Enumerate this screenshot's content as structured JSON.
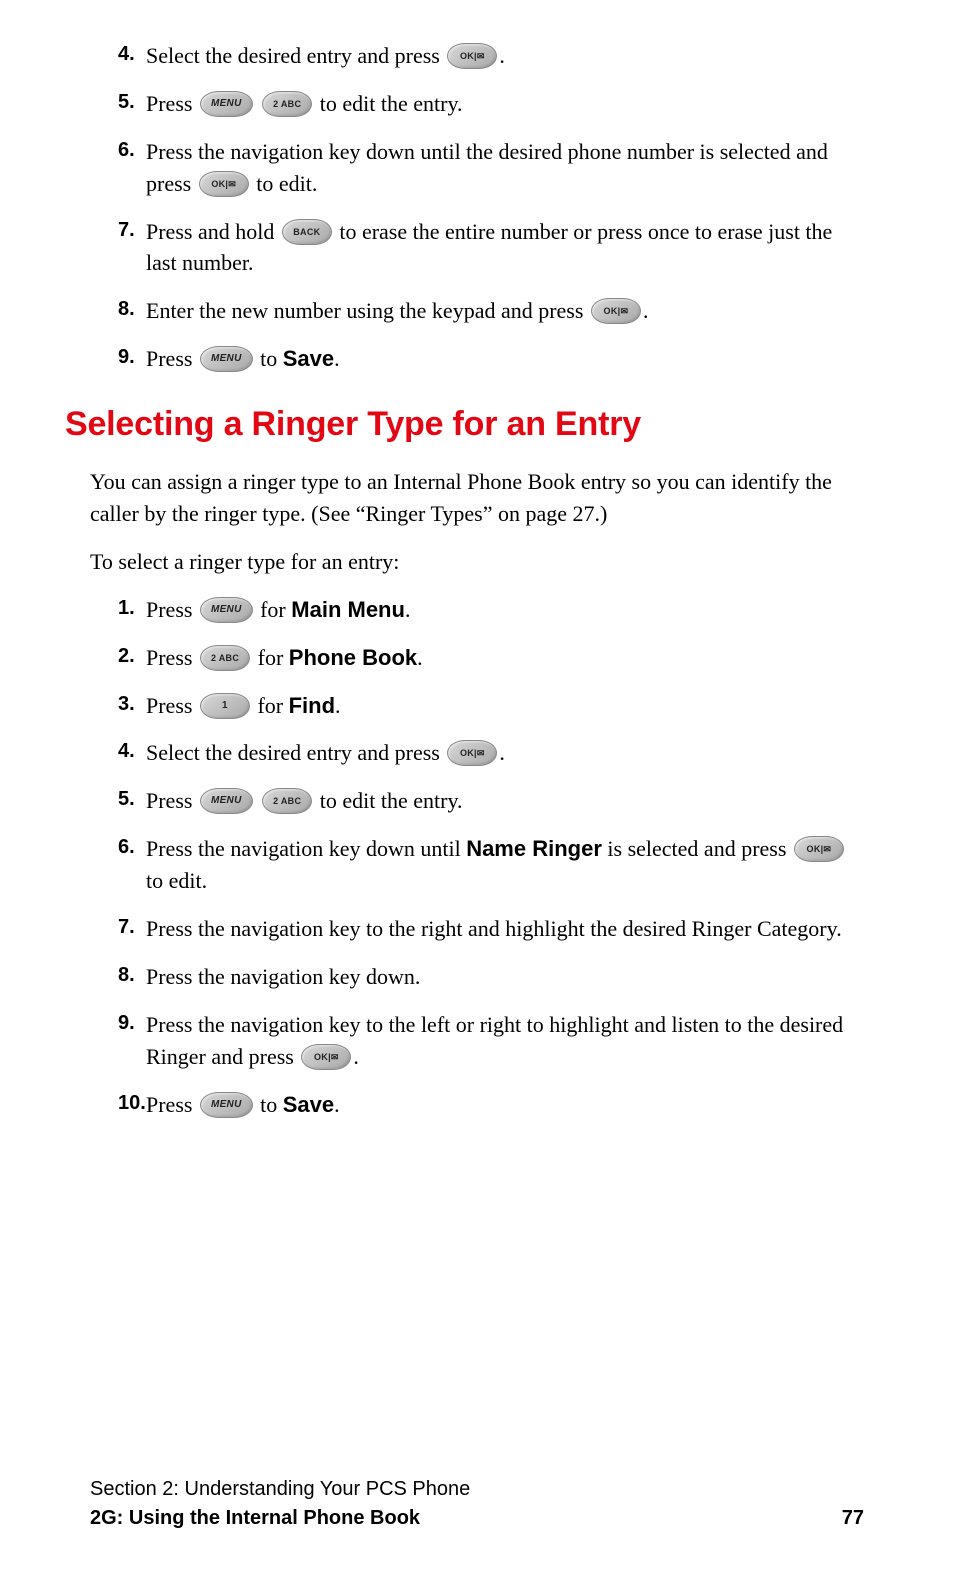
{
  "keys": {
    "ok": "OK|✉",
    "menu": "MENU",
    "two": "2 ABC",
    "one": "1",
    "back": "BACK"
  },
  "list1": {
    "s4": {
      "num": "4.",
      "t1": "Select the desired entry and press ",
      "t2": "."
    },
    "s5": {
      "num": "5.",
      "t1": "Press ",
      "t2": " to edit the entry."
    },
    "s6": {
      "num": "6.",
      "t1": "Press the navigation key down until the desired phone number is selected and press ",
      "t2": " to edit."
    },
    "s7": {
      "num": "7.",
      "t1": "Press and hold ",
      "t2": " to erase the entire number or press once to erase just the last number."
    },
    "s8": {
      "num": "8.",
      "t1": "Enter the new number using the keypad and press ",
      "t2": "."
    },
    "s9": {
      "num": "9.",
      "t1": "Press ",
      "t2": " to ",
      "bold": "Save",
      "t3": "."
    }
  },
  "heading": "Selecting a Ringer Type for an Entry",
  "para1": "You can assign a ringer type to an Internal Phone Book entry so you can identify the caller by the ringer type. (See “Ringer Types” on page 27.)",
  "para2": "To select a ringer type for an entry:",
  "list2": {
    "s1": {
      "num": "1.",
      "t1": "Press ",
      "t2": " for ",
      "bold": "Main Menu",
      "t3": "."
    },
    "s2": {
      "num": "2.",
      "t1": "Press ",
      "t2": " for ",
      "bold": "Phone Book",
      "t3": "."
    },
    "s3": {
      "num": "3.",
      "t1": "Press ",
      "t2": " for ",
      "bold": "Find",
      "t3": "."
    },
    "s4": {
      "num": "4.",
      "t1": "Select the desired entry and press ",
      "t2": "."
    },
    "s5": {
      "num": "5.",
      "t1": "Press ",
      "t2": " to edit the entry."
    },
    "s6": {
      "num": "6.",
      "t1": "Press the navigation key down until ",
      "bold": "Name Ringer",
      "t2": " is selected and press ",
      "t3": " to edit."
    },
    "s7": {
      "num": "7.",
      "t1": "Press the navigation key to the right and highlight the desired Ringer Category."
    },
    "s8": {
      "num": "8.",
      "t1": "Press the navigation key down."
    },
    "s9": {
      "num": "9.",
      "t1": "Press the navigation key to the left or right to highlight and listen to the desired Ringer and press ",
      "t2": "."
    },
    "s10": {
      "num": "10.",
      "t1": "Press ",
      "t2": " to ",
      "bold": "Save",
      "t3": "."
    }
  },
  "footer": {
    "line1": "Section 2: Understanding Your PCS Phone",
    "line2": "2G: Using the Internal Phone Book",
    "page": "77"
  }
}
